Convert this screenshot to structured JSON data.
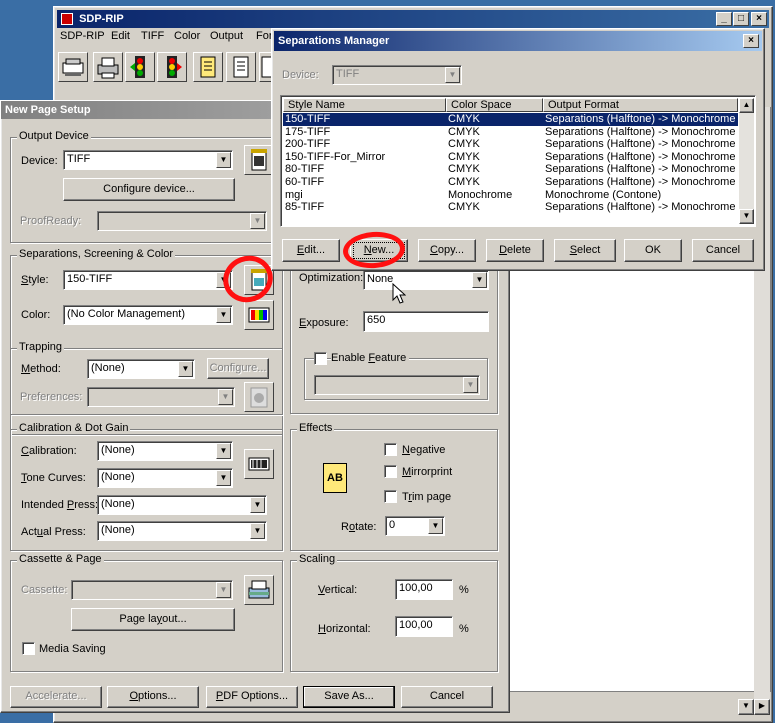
{
  "sdp_rip": {
    "title": "SDP-RIP",
    "menu": [
      "SDP-RIP",
      "Edit",
      "TIFF",
      "Color",
      "Output",
      "For"
    ],
    "toolbar_icons": [
      "scanner-icon",
      "printer-icon",
      "traffic-light-icon",
      "traffic-light-icon",
      "document-icon",
      "document-icon",
      "document-icon"
    ]
  },
  "page_setup": {
    "title": "New Page Setup",
    "output_device": {
      "legend": "Output Device",
      "device_label": "Device:",
      "device_value": "TIFF",
      "configure_label": "Configure device...",
      "proofready_label": "ProofReady:",
      "proofready_value": ""
    },
    "separations": {
      "legend": "Separations, Screening & Color",
      "style_label": "Style:",
      "style_value": "150-TIFF",
      "color_label": "Color:",
      "color_value": "(No Color Management)"
    },
    "optimization": {
      "label": "Optimization:",
      "value": "None",
      "exposure_label": "Exposure:",
      "exposure_value": "650",
      "enable_feature_label": "Enable Feature",
      "feature_value": ""
    },
    "trapping": {
      "legend": "Trapping",
      "method_label": "Method:",
      "method_value": "(None)",
      "configure_label": "Configure...",
      "preferences_label": "Preferences:",
      "preferences_value": ""
    },
    "calibration": {
      "legend": "Calibration & Dot Gain",
      "calibration_label": "Calibration:",
      "calibration_value": "(None)",
      "tone_label": "Tone Curves:",
      "tone_value": "(None)",
      "intended_label": "Intended Press:",
      "intended_value": "(None)",
      "actual_label": "Actual Press:",
      "actual_value": "(None)"
    },
    "effects": {
      "legend": "Effects",
      "negative_label": "Negative",
      "mirror_label": "Mirrorprint",
      "trim_label": "Trim page",
      "rotate_label": "Rotate:",
      "rotate_value": "0",
      "ab_icon_text": "AB"
    },
    "cassette": {
      "legend": "Cassette & Page",
      "cassette_label": "Cassette:",
      "cassette_value": "",
      "page_layout_label": "Page layout...",
      "media_saving_label": "Media Saving"
    },
    "scaling": {
      "legend": "Scaling",
      "vertical_label": "Vertical:",
      "vertical_value": "100,00",
      "horizontal_label": "Horizontal:",
      "horizontal_value": "100,00",
      "unit": "%"
    },
    "buttons": {
      "accelerate": "Accelerate...",
      "options": "Options...",
      "pdf_options": "PDF Options...",
      "save_as": "Save As...",
      "cancel": "Cancel"
    }
  },
  "sep_manager": {
    "title": "Separations Manager",
    "device_label": "Device:",
    "device_value": "TIFF",
    "columns": [
      "Style Name",
      "Color Space",
      "Output Format"
    ],
    "rows": [
      {
        "name": "150-TIFF",
        "space": "CMYK",
        "format": "Separations (Halftone) -> Monochrome"
      },
      {
        "name": "175-TIFF",
        "space": "CMYK",
        "format": "Separations (Halftone) -> Monochrome"
      },
      {
        "name": "200-TIFF",
        "space": "CMYK",
        "format": "Separations (Halftone) -> Monochrome"
      },
      {
        "name": "150-TIFF-For_Mirror",
        "space": "CMYK",
        "format": "Separations (Halftone) -> Monochrome"
      },
      {
        "name": "80-TIFF",
        "space": "CMYK",
        "format": "Separations (Halftone) -> Monochrome"
      },
      {
        "name": "60-TIFF",
        "space": "CMYK",
        "format": "Separations (Halftone) -> Monochrome"
      },
      {
        "name": "mgi",
        "space": "Monochrome",
        "format": "Monochrome (Contone)"
      },
      {
        "name": "85-TIFF",
        "space": "CMYK",
        "format": "Separations (Halftone) -> Monochrome"
      }
    ],
    "buttons": {
      "edit": "Edit...",
      "new": "New...",
      "copy": "Copy...",
      "delete": "Delete",
      "select": "Select",
      "ok": "OK",
      "cancel": "Cancel"
    }
  },
  "colors": {
    "titlebar_active": "#0a246a",
    "annotation_red": "#ff1010",
    "desktop": "#3a6ea5"
  }
}
